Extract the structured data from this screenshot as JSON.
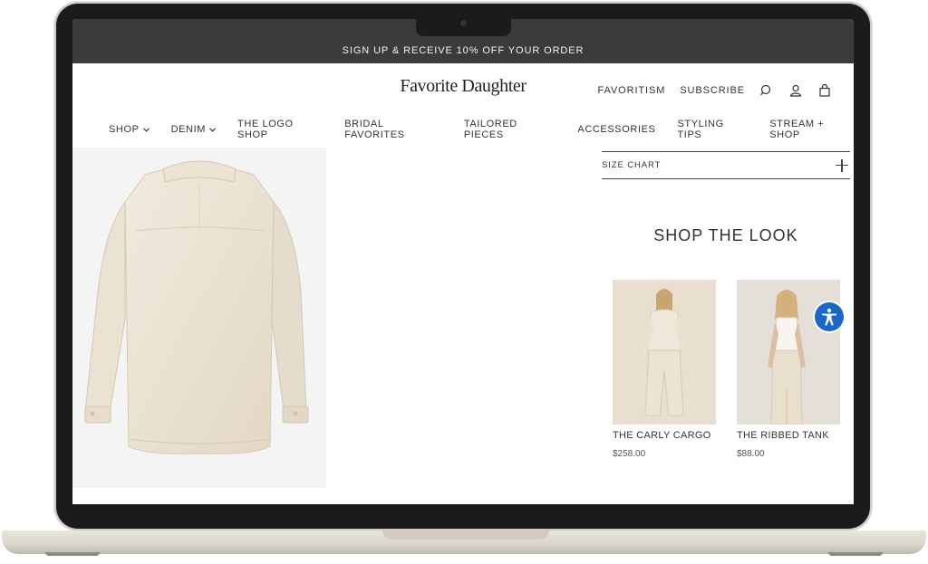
{
  "announcement": {
    "text": "SIGN UP & RECEIVE 10% OFF YOUR ORDER"
  },
  "header": {
    "logo": "Favorite Daughter",
    "links": [
      "FAVORITISM",
      "SUBSCRIBE"
    ],
    "icons": [
      "search-icon",
      "account-icon",
      "bag-icon"
    ]
  },
  "nav": {
    "items": [
      {
        "label": "SHOP",
        "dropdown": true
      },
      {
        "label": "DENIM",
        "dropdown": true
      },
      {
        "label": "THE LOGO SHOP"
      },
      {
        "label": "BRIDAL FAVORITES"
      },
      {
        "label": "TAILORED PIECES"
      },
      {
        "label": "ACCESSORIES"
      },
      {
        "label": "STYLING TIPS"
      },
      {
        "label": "STREAM + SHOP"
      }
    ]
  },
  "product": {
    "image_icon": "shirt-jacket-image"
  },
  "size_chart": {
    "label": "SIZE CHART"
  },
  "shop_the_look": {
    "title": "SHOP THE LOOK",
    "items": [
      {
        "name": "THE CARLY CARGO",
        "price": "$258.00"
      },
      {
        "name": "THE RIBBED TANK",
        "price": "$88.00"
      }
    ]
  },
  "colors": {
    "announce_bg": "#3b3b3b",
    "accessibility": "#1a66c9",
    "product_cream": "#efe7da"
  }
}
